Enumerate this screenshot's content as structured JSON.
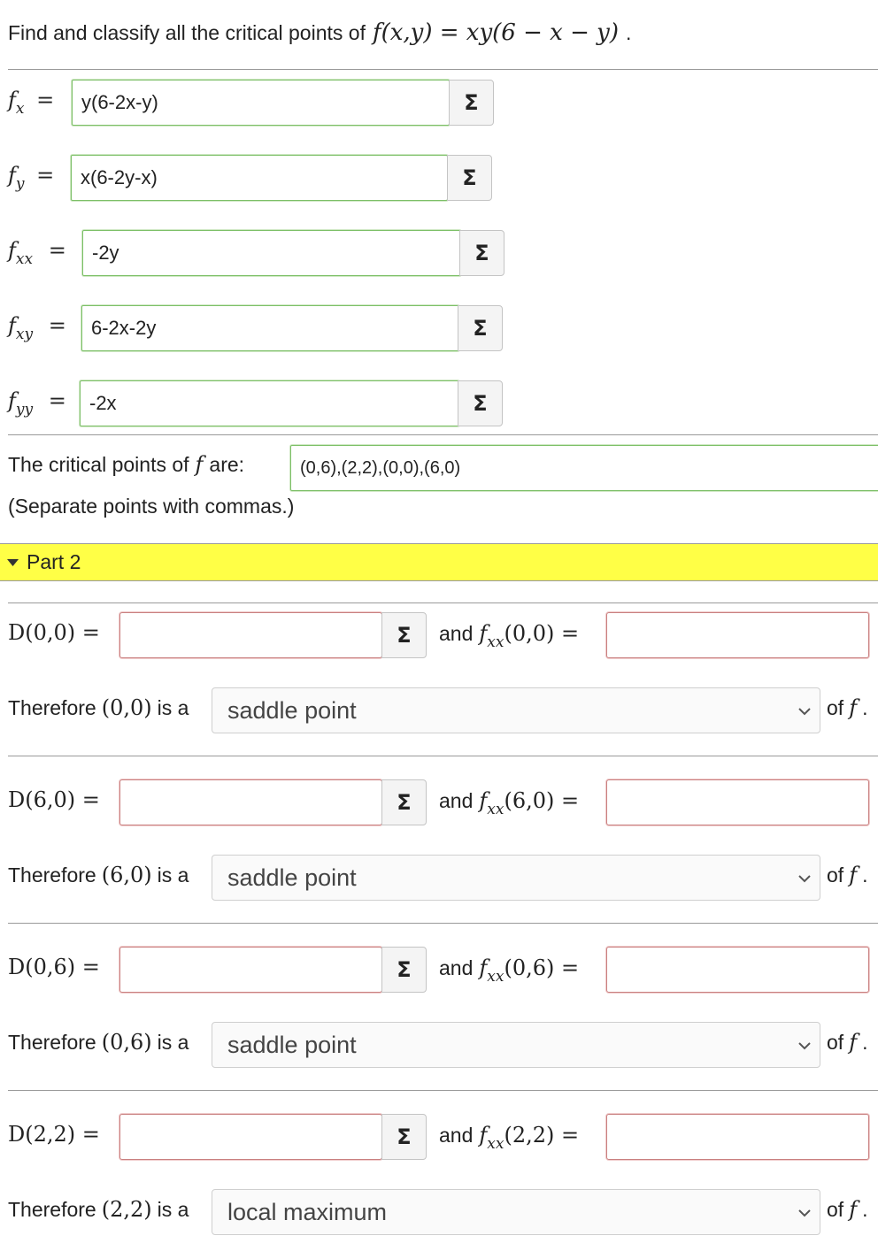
{
  "question": {
    "prefix": "Find and classify all the critical points of",
    "func_math": "f(x,y) = xy(6 − x − y)",
    "suffix": "."
  },
  "partials": [
    {
      "label": "f",
      "sub": "x",
      "value": "y(6-2x-y)"
    },
    {
      "label": "f",
      "sub": "y",
      "value": "x(6-2y-x)"
    },
    {
      "label": "f",
      "sub": "xx",
      "value": "-2y"
    },
    {
      "label": "f",
      "sub": "xy",
      "value": "6-2x-2y"
    },
    {
      "label": "f",
      "sub": "yy",
      "value": "-2x"
    }
  ],
  "equals": "=",
  "sigma": "Σ",
  "critical": {
    "prefix": "The critical points of",
    "f": "f",
    "suffix": "are:",
    "value": "(0,6),(2,2),(0,0),(6,0)",
    "hint": "(Separate points with commas.)"
  },
  "part2": {
    "label": "Part 2"
  },
  "points": [
    {
      "pt": "(0,0)",
      "D_label": "D(0,0) =",
      "and": "and",
      "fxx_pt": "(0,0) =",
      "therefore": "Therefore",
      "is_a": "is a",
      "classification": "saddle point",
      "of": "of",
      "f": "f",
      "period": ".",
      "D_value": "",
      "fxx_value": ""
    },
    {
      "pt": "(6,0)",
      "D_label": "D(6,0) =",
      "and": "and",
      "fxx_pt": "(6,0) =",
      "therefore": "Therefore",
      "is_a": "is a",
      "classification": "saddle point",
      "of": "of",
      "f": "f",
      "period": ".",
      "D_value": "",
      "fxx_value": ""
    },
    {
      "pt": "(0,6)",
      "D_label": "D(0,6) =",
      "and": "and",
      "fxx_pt": "(0,6) =",
      "therefore": "Therefore",
      "is_a": "is a",
      "classification": "saddle point",
      "of": "of",
      "f": "f",
      "period": ".",
      "D_value": "",
      "fxx_value": ""
    },
    {
      "pt": "(2,2)",
      "D_label": "D(2,2) =",
      "and": "and",
      "fxx_pt": "(2,2) =",
      "therefore": "Therefore",
      "is_a": "is a",
      "classification": "local maximum",
      "of": "of",
      "f": "f",
      "period": ".",
      "D_value": "",
      "fxx_value": ""
    }
  ]
}
